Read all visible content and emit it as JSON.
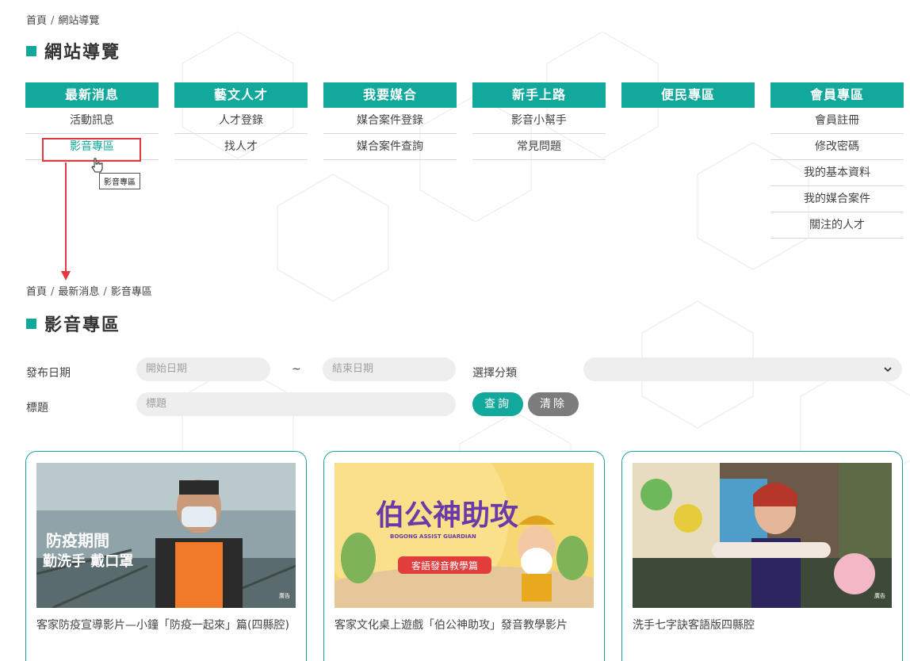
{
  "sitemap": {
    "breadcrumb": [
      "首頁",
      "網站導覽"
    ],
    "title": "網站導覽",
    "columns": [
      {
        "heading": "最新消息",
        "items": [
          "活動訊息",
          "影音專區"
        ]
      },
      {
        "heading": "藝文人才",
        "items": [
          "人才登錄",
          "找人才"
        ]
      },
      {
        "heading": "我要媒合",
        "items": [
          "媒合案件登錄",
          "媒合案件查詢"
        ]
      },
      {
        "heading": "新手上路",
        "items": [
          "影音小幫手",
          "常見問題"
        ]
      },
      {
        "heading": "便民專區",
        "items": []
      },
      {
        "heading": "會員專區",
        "items": [
          "會員註冊",
          "修改密碼",
          "我的基本資料",
          "我的媒合案件",
          "關注的人才"
        ]
      }
    ],
    "tooltip": "影音專區"
  },
  "media": {
    "breadcrumb": [
      "首頁",
      "最新消息",
      "影音專區"
    ],
    "title": "影音專區",
    "filters": {
      "date_label": "發布日期",
      "start_placeholder": "開始日期",
      "tilde": "~",
      "end_placeholder": "結束日期",
      "category_label": "選擇分類",
      "title_label": "標題",
      "title_placeholder": "標題",
      "search_button": "查詢",
      "clear_button": "清除"
    },
    "cards": [
      {
        "title": "客家防疫宣導影片—小鐘「防疫一起來」篇(四縣腔)",
        "thumb_caption_1": "防疫期間",
        "thumb_caption_2": "勤洗手 戴口罩",
        "corner_tag": "廣告"
      },
      {
        "title": "客家文化桌上遊戲「伯公神助攻」發音教學影片",
        "thumb_caption_1": "伯公神助攻",
        "thumb_caption_2": "BOGONG ASSIST GUARDIAN",
        "thumb_caption_3": "客語發音教學篇"
      },
      {
        "title": "洗手七字訣客語版四縣腔",
        "corner_tag": "廣告"
      }
    ]
  },
  "colors": {
    "accent": "#12a89b",
    "highlight": "#e0393e",
    "clear_button": "#7c7c7c"
  },
  "icons": [
    "chevron-down-icon",
    "hand-pointer-icon"
  ]
}
